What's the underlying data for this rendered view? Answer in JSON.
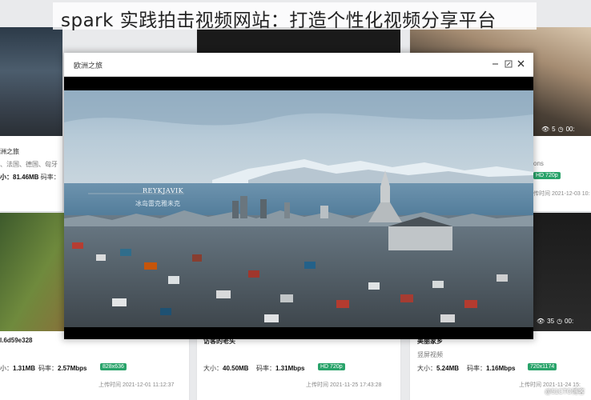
{
  "banner": {
    "title": "spark 实践拍击视频网站：打造个性化视频分享平台"
  },
  "modal": {
    "title": "欧洲之旅",
    "video_overlay_en": "REYKJAVIK",
    "video_overlay_cn": "冰岛雷克雅未克"
  },
  "cards": {
    "left_mid": {
      "title": "洲之旅",
      "sub": "、法国、德国、匈牙",
      "meta_size": "小：81.46MB",
      "meta_rate": "码率："
    },
    "right_mid": {
      "sub": "ons",
      "badge": "HD 720p",
      "uptime": "传时间 2021-12-03 10:"
    },
    "right_top": {
      "views": "5",
      "duration": "00:"
    },
    "left_bottom": {
      "title": "l.6d59e328",
      "size_label": "小：",
      "size_value": "1.31MB",
      "rate_label": "码率：",
      "rate_value": "2.57Mbps",
      "badge": "828x636",
      "uptime": "上传时间 2021-12-01 11:12:37"
    },
    "mid_bottom": {
      "title": "访客的老头",
      "size_label": "大小：",
      "size_value": "40.50MB",
      "rate_label": "码率：",
      "rate_value": "1.31Mbps",
      "badge": "HD 720p",
      "uptime": "上传时间 2021-11-25 17:43:28"
    },
    "right_bottom": {
      "title": "美丽家乡",
      "sub": "竖屏视频",
      "size_label": "大小：",
      "size_value": "5.24MB",
      "rate_label": "码率：",
      "rate_value": "1.16Mbps",
      "badge": "720x1174",
      "uptime": "上传时间 2021-11-24 15:",
      "views": "35",
      "duration": "00:"
    }
  },
  "watermark": "@51CTO博客",
  "colors": {
    "badge_green": "#29a36a",
    "modal_header": "#ffffff",
    "page_bg": "#e9eaec"
  }
}
